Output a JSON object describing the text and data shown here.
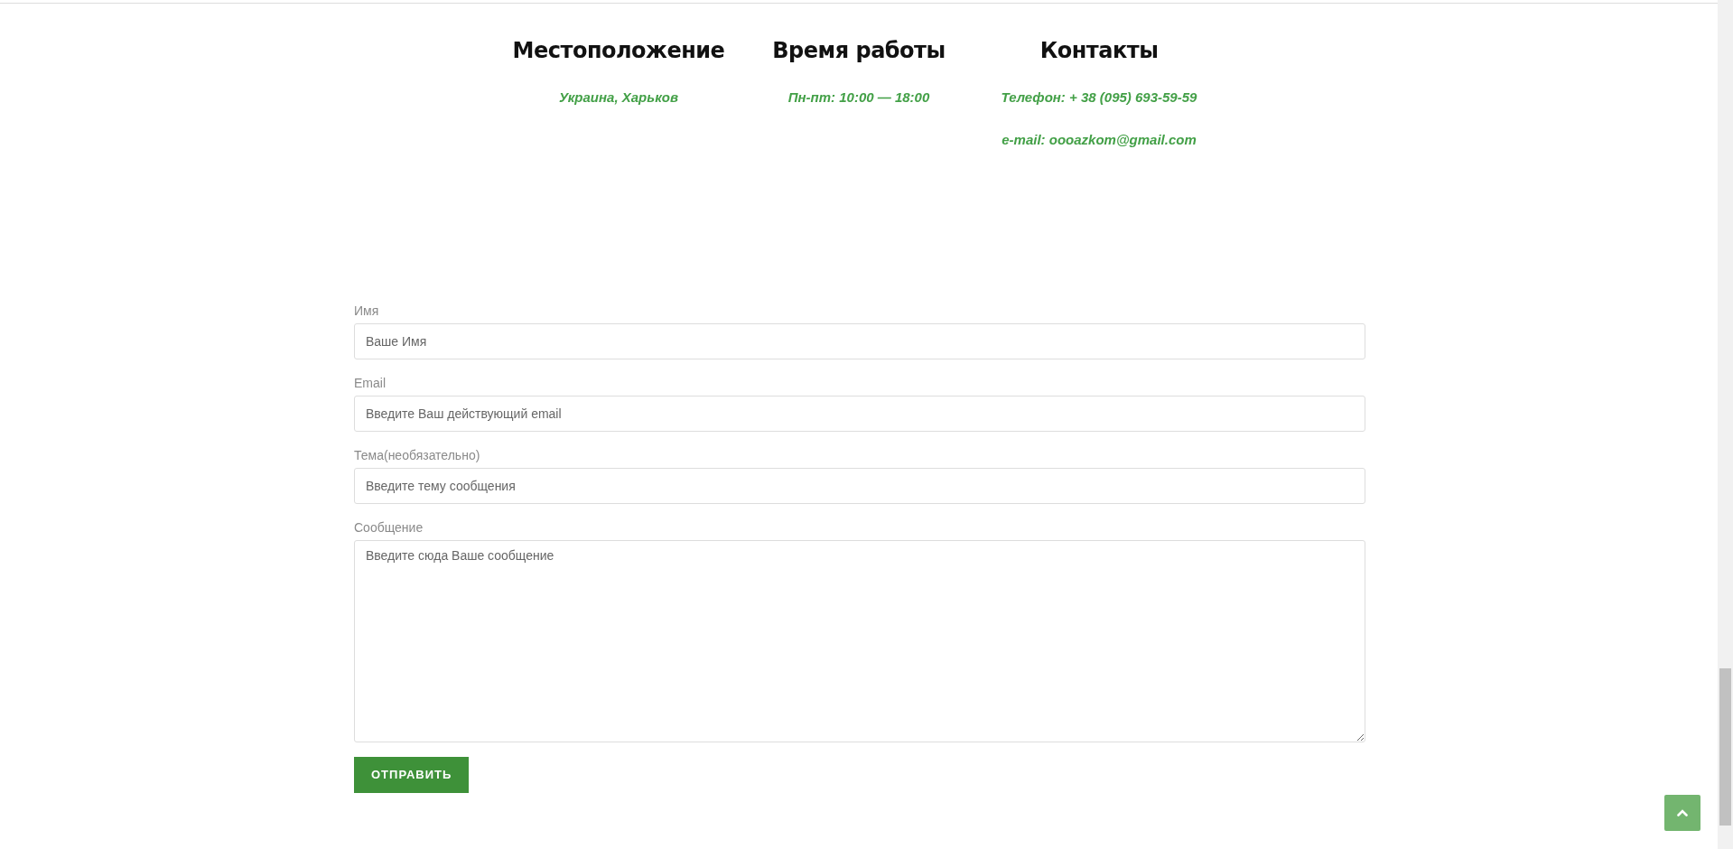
{
  "info_columns": [
    {
      "title": "Местоположение",
      "lines": [
        "Украина, Харьков"
      ]
    },
    {
      "title": "Время работы",
      "lines": [
        "Пн-пт: 10:00 — 18:00"
      ]
    },
    {
      "title": "Контакты",
      "lines": [
        "Телефон: + 38 (095) 693-59-59",
        "e-mail: oooazkom@gmail.com"
      ]
    }
  ],
  "form": {
    "fields": [
      {
        "kind": "input",
        "label": "Имя",
        "placeholder": "Ваше Имя"
      },
      {
        "kind": "input",
        "label": "Email",
        "placeholder": "Введите Ваш действующий email"
      },
      {
        "kind": "input",
        "label": "Тема(необязательно)",
        "placeholder": "Введите тему сообщения"
      },
      {
        "kind": "textarea",
        "label": "Сообщение",
        "placeholder": "Введите сюда Ваше сообщение"
      }
    ],
    "submit_button": "ОТПРАВИТЬ"
  }
}
